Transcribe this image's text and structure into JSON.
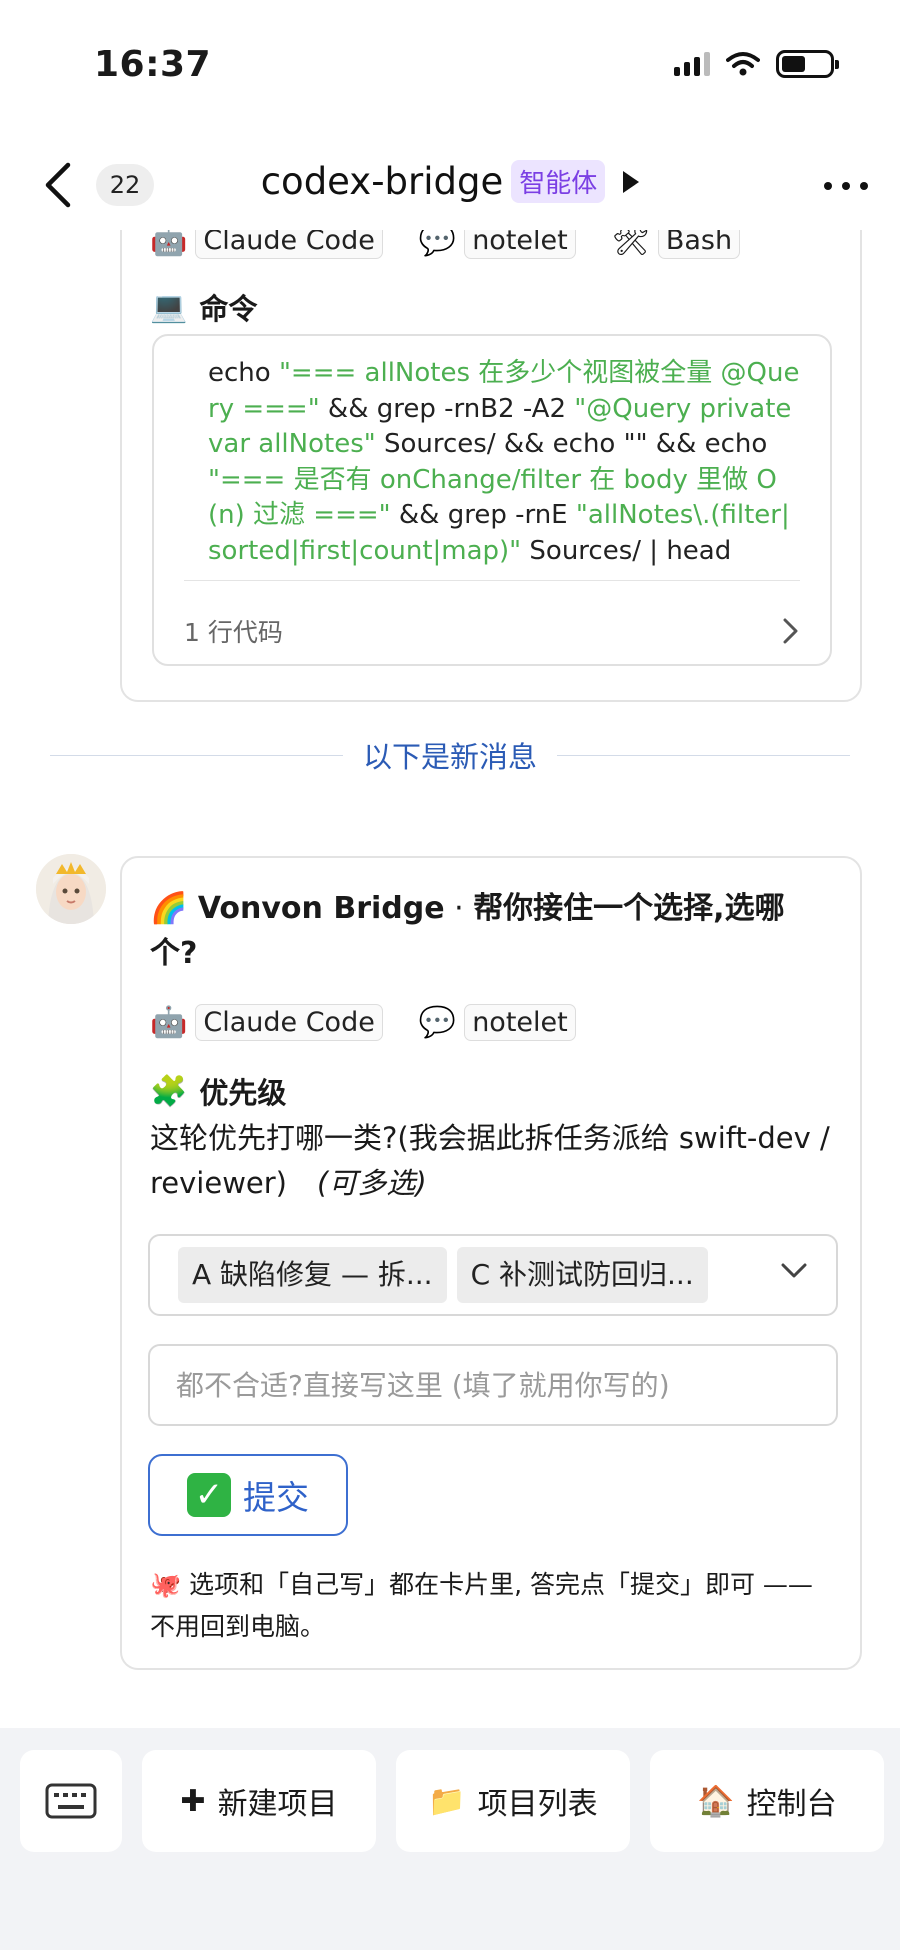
{
  "status": {
    "time": "16:37"
  },
  "nav": {
    "back_count": "22",
    "title": "codex-bridge",
    "agent_tag": "智能体"
  },
  "card_top": {
    "chips": [
      {
        "emoji": "🤖",
        "label": "Claude Code"
      },
      {
        "emoji": "💬",
        "label": "notelet"
      },
      {
        "emoji": "🛠",
        "label": "Bash"
      }
    ],
    "command_icon": "💻",
    "command_title": "命令",
    "code": {
      "p1": "echo ",
      "s1": "\"=== allNotes 在多少个视图被全量 @Query ===\"",
      "p2": " && grep -rnB2 -A2 ",
      "s2": "\"@Query private var allNotes\"",
      "p3": " Sources/ && echo \"\" && echo ",
      "s3": "\"=== 是否有 onChange/filter 在 body 里做 O(n) 过滤 ===\"",
      "p4": " && grep -rnE ",
      "s4": "\"allNotes\\.(filter|sorted|first|count|map)\"",
      "p5": " Sources/ | head"
    },
    "code_lines": "1 行代码"
  },
  "divider_text": "以下是新消息",
  "card_msg": {
    "title_emoji": "🌈",
    "title_name": "Vonvon Bridge",
    "title_sep": " · ",
    "title_text": "帮你接住一个选择,选哪个?",
    "chips": [
      {
        "emoji": "🤖",
        "label": "Claude Code"
      },
      {
        "emoji": "💬",
        "label": "notelet"
      }
    ],
    "section_icon": "🧩",
    "section_title": "优先级",
    "question": "这轮优先打哪一类?(我会据此拆任务派给 swift-dev / reviewer)",
    "question_hint": "(可多选)",
    "selected_options": [
      "A 缺陷修复 — 拆...",
      "C 补测试防回归..."
    ],
    "input_placeholder": "都不合适?直接写这里 (填了就用你写的)",
    "submit_icon": "✓",
    "submit_label": "提交",
    "footnote_emoji": "🐙",
    "footnote": "选项和「自己写」都在卡片里, 答完点「提交」即可 —— 不用回到电脑。"
  },
  "bottom_bar": {
    "new_icon": "✚",
    "new_label": "新建项目",
    "list_icon": "📁",
    "list_label": "项目列表",
    "console_icon": "🏠",
    "console_label": "控制台"
  },
  "colors": {
    "accent": "#2f62c9",
    "string_green": "#4caf50",
    "agent_purple": "#7b3fe4",
    "submit_check": "#2fb344"
  }
}
